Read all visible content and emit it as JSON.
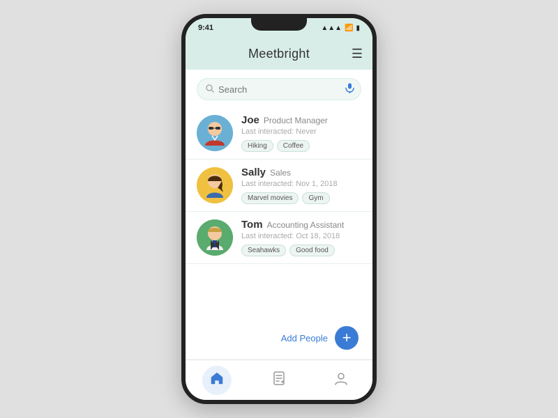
{
  "app": {
    "title": "Meetbright"
  },
  "status_bar": {
    "time": "9:41",
    "icons": "▲ ▲ ▲"
  },
  "search": {
    "placeholder": "Search"
  },
  "people": [
    {
      "name": "Joe",
      "role": "Product Manager",
      "last_interacted": "Last interacted: Never",
      "tags": [
        "Hiking",
        "Coffee"
      ],
      "avatar_color": "#6ab0d4",
      "avatar_type": "joe"
    },
    {
      "name": "Sally",
      "role": "Sales",
      "last_interacted": "Last interacted: Nov 1, 2018",
      "tags": [
        "Marvel movies",
        "Gym"
      ],
      "avatar_color": "#f0c040",
      "avatar_type": "sally"
    },
    {
      "name": "Tom",
      "role": "Accounting Assistant",
      "last_interacted": "Last interacted: Oct 18, 2018",
      "tags": [
        "Seahawks",
        "Good food"
      ],
      "avatar_color": "#5aab6e",
      "avatar_type": "tom"
    }
  ],
  "add_people_label": "Add People",
  "nav": {
    "items": [
      {
        "icon": "home",
        "label": "Home",
        "active": true
      },
      {
        "icon": "notes",
        "label": "Notes",
        "active": false
      },
      {
        "icon": "profile",
        "label": "Profile",
        "active": false
      }
    ]
  }
}
